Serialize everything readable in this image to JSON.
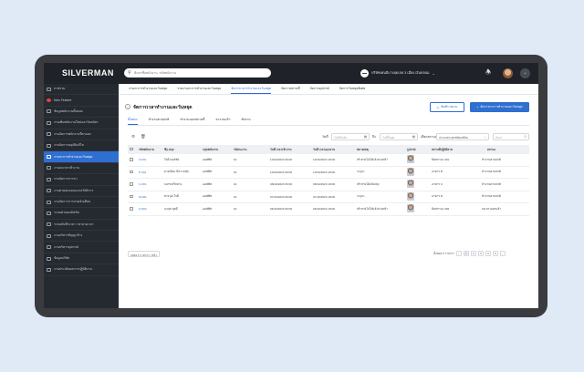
{
  "app": {
    "logo": "SILVERMAN"
  },
  "search": {
    "placeholder": "ค้นหาชื่อพนักงาน, รหัสพนักงาน"
  },
  "header": {
    "company": "บริษัทเคนอิบางจุดเลย 3 เมี่ยง เงินดจอม"
  },
  "sidebar": {
    "items": [
      {
        "label": "ภาพรวม",
        "icon": "dashboard-icon"
      },
      {
        "label": "New Feature",
        "icon": "new-feature-icon"
      },
      {
        "label": "ข้อมูลพนักงานทั้งหมด",
        "icon": "users-icon"
      },
      {
        "label": "งานเพิ่มพนักงานใหม่และรับสมัคร",
        "icon": "user-add-icon"
      },
      {
        "label": "งานจัดการพนักงานที่ลาออก",
        "icon": "user-exit-icon"
      },
      {
        "label": "งานจัดการอนุมัติแก้ไข",
        "icon": "approve-icon"
      },
      {
        "label": "งานกะการทำงานและวันหยุด",
        "icon": "calendar-icon",
        "active": true
      },
      {
        "label": "งานลงเวลาเข้างาน",
        "icon": "clock-icon"
      },
      {
        "label": "งานจัดการการลา",
        "icon": "leave-icon"
      },
      {
        "label": "งานค่าตอบแทนและสวัสดิการ",
        "icon": "benefit-icon"
      },
      {
        "label": "งานจัดการการจ่ายเงินเดือน",
        "icon": "payroll-icon"
      },
      {
        "label": "ระบบค่าคอมมิชชัน",
        "icon": "commission-icon"
      },
      {
        "label": "ระบบบันทึกเวลา / ค่าล่วงเวลา",
        "icon": "timesheet-icon"
      },
      {
        "label": "งานบริหารสัญญาจ้าง",
        "icon": "contract-icon"
      },
      {
        "label": "งานบริหารอุปกรณ์",
        "icon": "device-icon"
      },
      {
        "label": "ข้อมูลบริษัท",
        "icon": "company-icon"
      },
      {
        "label": "งานประเมินผลการปฏิบัติงาน",
        "icon": "evaluation-icon"
      }
    ]
  },
  "subnav": {
    "items": [
      "งานกะการทำงานและวันหยุด",
      "รายงานกะการทำงานและวันหยุด",
      "จัดการเวลาทำงานและวันหยุด",
      "จัดการสถานที่",
      "จัดการอุปกรณ์",
      "จัดการวันหยุดพิเศษ"
    ],
    "active_index": 2
  },
  "page": {
    "title": "จัดการเวลาทำงานและวันหยุด",
    "export_label": "พิมพ์รายงาน",
    "add_label": "จัดการกะการทำงานและวันหยุด"
  },
  "tabs": {
    "items": [
      "ทั้งหมด",
      "ทำงานตามปกติ",
      "ทำงานนอกสถานที่",
      "ลางานแล้ว",
      "พักงาน"
    ],
    "active_index": 0
  },
  "filter": {
    "date_label": "วันที่",
    "date_from_placeholder": "วันที่เริ่มต้น",
    "to_label": "ถึง",
    "date_to_placeholder": "วันที่สิ้นสุด",
    "type_label": "เลือกสถานะ",
    "type_value": "ประเภทกะทุกชนิดเหมือน",
    "search_placeholder": "ค้นหา"
  },
  "table": {
    "headers": [
      "รหัสพนักงาน",
      "ชื่อ-สกุล",
      "กลุ่มพนักงาน",
      "รหัสกะงาน",
      "วันที่ เวลาเข้างาน",
      "วันที่ เวลาออกงาน",
      "หมายเหตุ",
      "รูปภาพ",
      "สถานที่ปฏิบัติงาน",
      "สถานะ"
    ],
    "rows": [
      {
        "code": "O-001",
        "name": "ใจดี มนต์ชัย",
        "group": "ออฟฟิศ",
        "shift": "01",
        "in": "10/10/2023 09:00",
        "out": "10/10/2023 18:00",
        "note": "เข้าสายไม่ได้แจ้งล่วงหน้า",
        "location": "ปิดสถานะ 001",
        "status": "ทำงานตามปกติ"
      },
      {
        "code": "P-001",
        "name": "ดวงเดือน มีความสุข",
        "group": "ออฟฟิศ",
        "shift": "01",
        "in": "10/10/2023 09:00",
        "out": "10/10/2023 18:00",
        "note": "ระบุกะ",
        "location": "อาคาร B",
        "status": "ทำงานตามปกติ"
      },
      {
        "code": "C-001",
        "name": "บงกช ศรีสยาม",
        "group": "ออฟฟิศ",
        "shift": "01",
        "in": "08/10/2023 09:00",
        "out": "08/10/2023 18:00",
        "note": "เข้าสายได้แจ้งเหตุ",
        "location": "อาคาร C",
        "status": "ทำงานตามปกติ"
      },
      {
        "code": "M-001",
        "name": "ทรงวุฒิ ใจดี",
        "group": "ออฟฟิศ",
        "shift": "01",
        "in": "07/10/2023 09:00",
        "out": "07/10/2023 18:00",
        "note": "ระบุกะ",
        "location": "อาคาร D",
        "status": "ทำงานตามปกติ"
      },
      {
        "code": "O-002",
        "name": "นงนุช สุดดี",
        "group": "ออฟฟิศ",
        "shift": "01",
        "in": "06/10/2023 09:00",
        "out": "06/10/2023 18:00",
        "note": "เข้าสายไม่ได้แจ้งล่วงหน้า",
        "location": "ปิดสถานะ 002",
        "status": "ลงเวลาออกแล้ว"
      }
    ]
  },
  "pagination": {
    "page_size": "แสดง 5 รายการ / หน้า",
    "summary": "ทั้งหมด 5 รายการ",
    "pages": [
      "‹",
      "1",
      "2",
      "3",
      "4",
      "5",
      "›"
    ]
  },
  "colors": {
    "accent": "#2f6fd0",
    "sidebar": "#252a31",
    "topbar": "#1f2329"
  }
}
